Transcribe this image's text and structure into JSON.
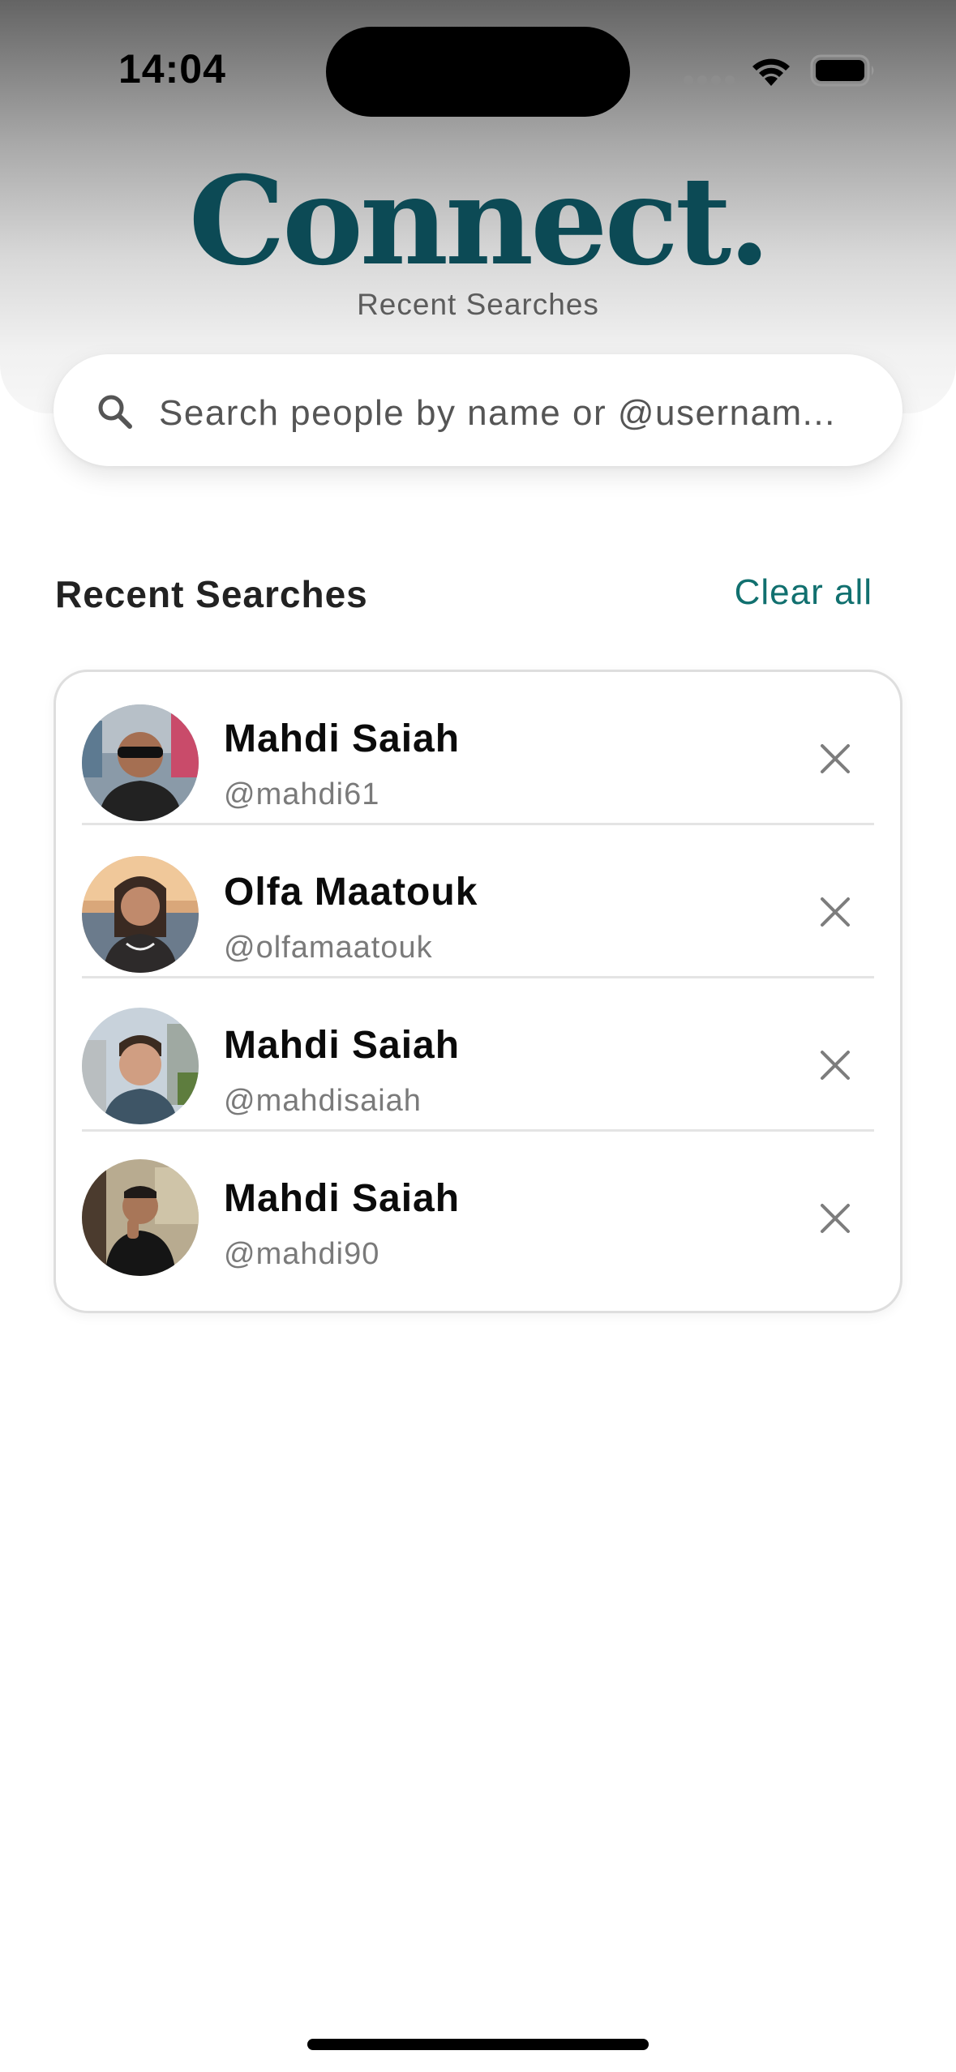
{
  "status_bar": {
    "time": "14:04"
  },
  "header": {
    "brand": "Connect.",
    "subtitle": "Recent Searches",
    "brand_color": "#0c4a55"
  },
  "search": {
    "icon": "search-icon",
    "placeholder": "Search people by name or @usernam..."
  },
  "recent": {
    "title": "Recent Searches",
    "clear_label": "Clear all",
    "accent_color": "#11706f",
    "items": [
      {
        "name": "Mahdi Saiah",
        "handle": "@mahdi61"
      },
      {
        "name": "Olfa Maatouk",
        "handle": "@olfamaatouk"
      },
      {
        "name": "Mahdi Saiah",
        "handle": "@mahdisaiah"
      },
      {
        "name": "Mahdi Saiah",
        "handle": "@mahdi90"
      }
    ]
  }
}
